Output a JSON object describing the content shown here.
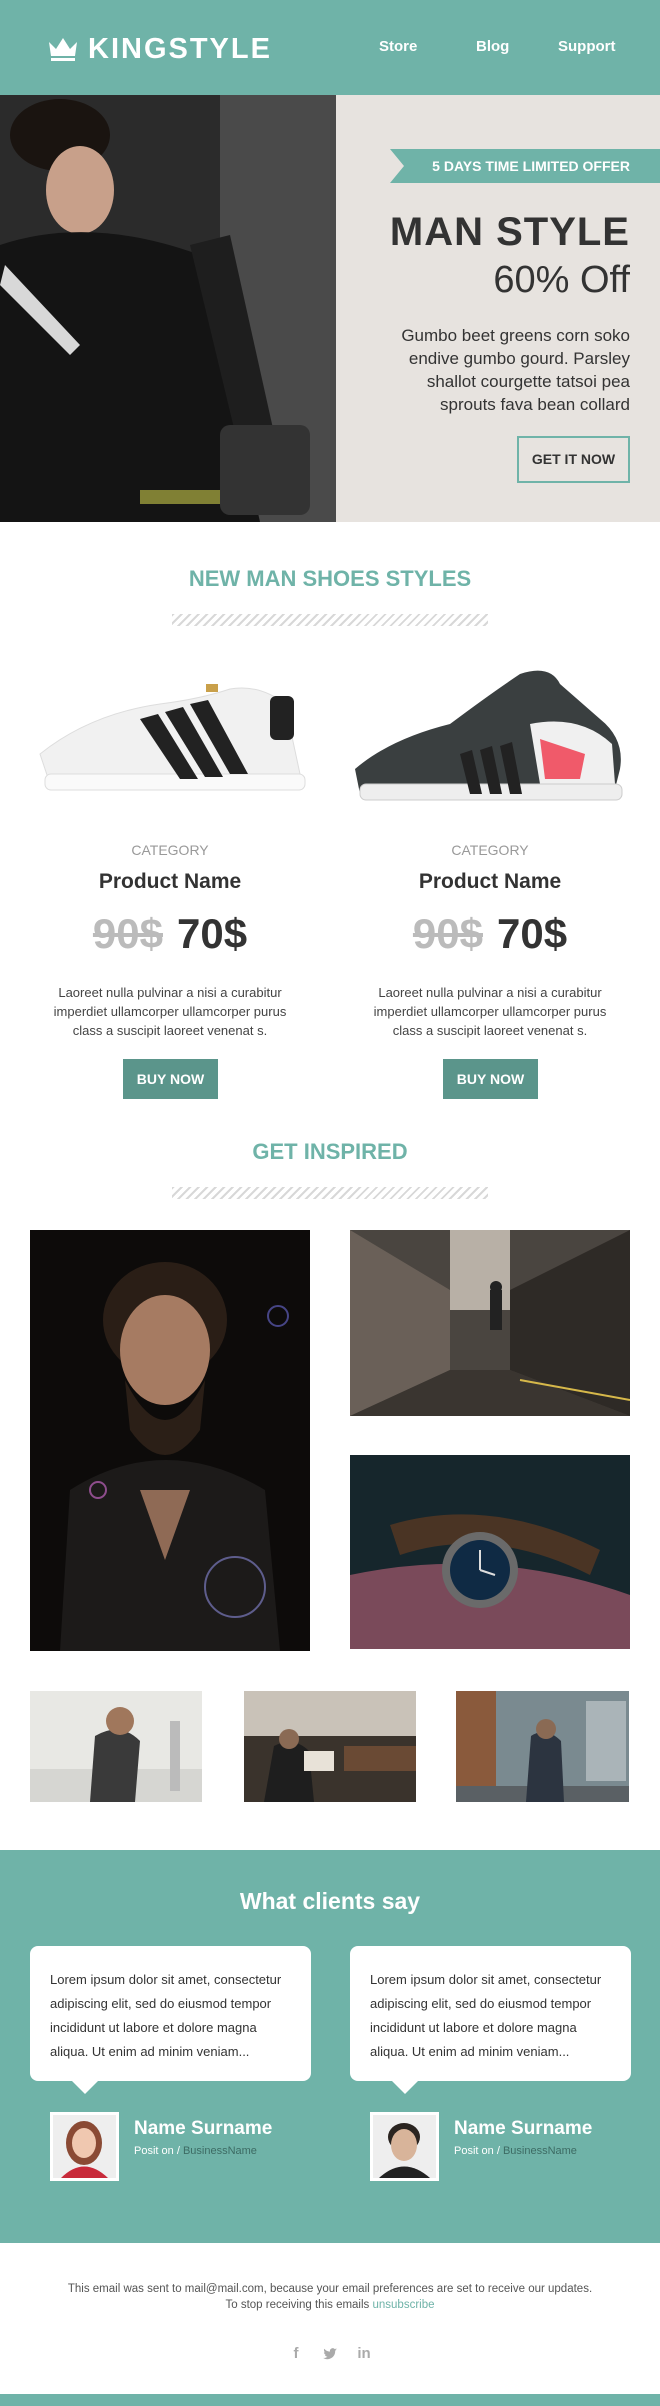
{
  "header": {
    "logo_text": "KINGSTYLE",
    "nav": [
      "Store",
      "Blog",
      "Support"
    ]
  },
  "hero": {
    "ribbon": "5 DAYS TIME LIMITED OFFER",
    "title": "MAN STYLE",
    "subtitle": "60% Off",
    "text": "Gumbo beet greens corn soko endive gumbo gourd. Parsley shallot courgette tatsoi pea sprouts fava bean collard",
    "cta": "GET IT NOW"
  },
  "products_section": {
    "title": "NEW MAN SHOES STYLES",
    "items": [
      {
        "category": "CATEGORY",
        "name": "Product Name",
        "old_price": "90$",
        "new_price": "70$",
        "description": "Laoreet nulla pulvinar a nisi a curabitur imperdiet ullamcorper ullamcorper purus class a suscipit laoreet venenat s.",
        "button": "BUY NOW"
      },
      {
        "category": "CATEGORY",
        "name": "Product Name",
        "old_price": "90$",
        "new_price": "70$",
        "description": "Laoreet nulla pulvinar a nisi a curabitur imperdiet ullamcorper ullamcorper purus class a suscipit laoreet venenat s.",
        "button": "BUY NOW"
      }
    ]
  },
  "inspired": {
    "title": "GET INSPIRED"
  },
  "testimonials": {
    "title": "What clients say",
    "items": [
      {
        "quote": "Lorem ipsum dolor sit amet, consectetur adipiscing elit, sed do eiusmod tempor incididunt ut labore et dolore magna aliqua. Ut enim ad minim veniam...",
        "name": "Name Surname",
        "position": "Posit on",
        "separator": "/",
        "business": "BusinessName"
      },
      {
        "quote": "Lorem ipsum dolor sit amet, consectetur adipiscing elit, sed do eiusmod tempor incididunt ut labore et dolore magna aliqua. Ut enim ad minim veniam...",
        "name": "Name Surname",
        "position": "Posit on",
        "separator": "/",
        "business": "BusinessName"
      }
    ]
  },
  "footer": {
    "line1": "This email was sent to mail@mail.com, because your email preferences are set to receive our updates.",
    "line2": "To stop receiving this emails",
    "unsubscribe": "unsubscribe",
    "social_icons": [
      "facebook-icon",
      "twitter-icon",
      "linkedin-icon"
    ]
  },
  "colors": {
    "accent": "#6fb3a8",
    "button": "#5b958b",
    "hero_bg": "#e7e3df"
  }
}
